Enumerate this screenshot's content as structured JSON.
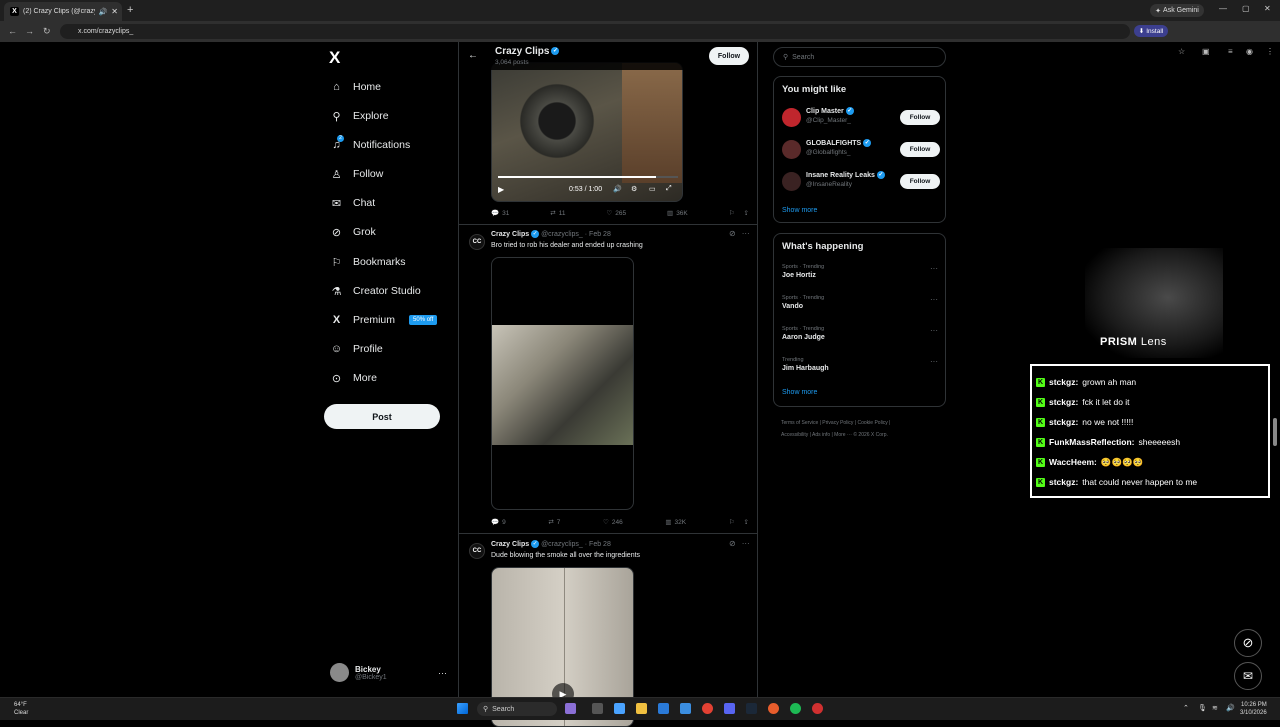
{
  "browser": {
    "tab_title": "(2) Crazy Clips (@crazyclips_",
    "new_tab": "+",
    "ask_gemini": "Ask Gemini",
    "url": "x.com/crazyclips_",
    "install": "Install",
    "window_controls": [
      "—",
      "▢",
      "✕"
    ]
  },
  "sidebar": {
    "logo": "X",
    "items": [
      {
        "label": "Home",
        "icon": "home-icon",
        "glyph": "⌂"
      },
      {
        "label": "Explore",
        "icon": "search-icon",
        "glyph": "⚲"
      },
      {
        "label": "Notifications",
        "icon": "bell-icon",
        "glyph": "🔔"
      },
      {
        "label": "Follow",
        "icon": "add-person-icon",
        "glyph": "⁺"
      },
      {
        "label": "Chat",
        "icon": "mail-icon",
        "glyph": "✉"
      },
      {
        "label": "Grok",
        "icon": "grok-icon",
        "glyph": "⊘"
      },
      {
        "label": "Bookmarks",
        "icon": "bookmark-icon",
        "glyph": "⚑"
      },
      {
        "label": "Creator Studio",
        "icon": "flask-icon",
        "glyph": "⚗"
      },
      {
        "label": "Premium",
        "icon": "x-logo-icon",
        "glyph": "X"
      },
      {
        "label": "Profile",
        "icon": "person-icon",
        "glyph": "☺"
      },
      {
        "label": "More",
        "icon": "more-circle-icon",
        "glyph": "⋯"
      }
    ],
    "premium_badge": "50% off",
    "notifications_count": "2",
    "post_button": "Post",
    "account": {
      "name": "Bickey",
      "handle": "@Bickey1",
      "more": "···"
    }
  },
  "main": {
    "title": "Crazy Clips",
    "subtitle": "3,064 posts",
    "follow": "Follow",
    "video1": {
      "time": "0:53 / 1:00",
      "progress": 0.88
    },
    "tweets": [
      {
        "actions": {
          "replies": "31",
          "reposts": "11",
          "likes": "265",
          "views": "36K"
        }
      },
      {
        "name": "Crazy Clips",
        "handle": "@crazyclips_",
        "date": "· Feb 28",
        "text": "Bro tried to rob his dealer and ended up crashing",
        "avatar_text": "CC",
        "actions": {
          "replies": "9",
          "reposts": "7",
          "likes": "246",
          "views": "32K"
        }
      },
      {
        "name": "Crazy Clips",
        "handle": "@crazyclips_",
        "date": "· Feb 28",
        "text": "Dude blowing the smoke all over the ingredients",
        "avatar_text": "CC"
      }
    ]
  },
  "right": {
    "search_placeholder": "Search",
    "you_might_like": {
      "title": "You might like",
      "accounts": [
        {
          "name": "Clip Master",
          "handle": "@Clip_Master_",
          "follow": "Follow"
        },
        {
          "name": "GLOBALFIGHTS",
          "handle": "@Globalfights_",
          "follow": "Follow"
        },
        {
          "name": "Insane Reality Leaks",
          "handle": "@InsaneReality",
          "follow": "Follow"
        }
      ],
      "show_more": "Show more"
    },
    "whats_happening": {
      "title": "What's happening",
      "trends": [
        {
          "context": "Sports · Trending",
          "topic": "Joe Hortiz"
        },
        {
          "context": "Sports · Trending",
          "topic": "Vando"
        },
        {
          "context": "Sports · Trending",
          "topic": "Aaron Judge"
        },
        {
          "context": "Trending",
          "topic": "Jim Harbaugh"
        }
      ],
      "show_more": "Show more"
    },
    "footer_line1": "Terms of Service  |  Privacy Policy  |  Cookie Policy  |",
    "footer_line2": "Accessibility  |  Ads info  |  More ···  © 2026 X Corp."
  },
  "stream": {
    "brand_bold": "PRISM",
    "brand_rest": " Lens",
    "chat": [
      {
        "user": "stckgz:",
        "msg": "grown ah man"
      },
      {
        "user": "stckgz:",
        "msg": "fck it let do it"
      },
      {
        "user": "stckgz:",
        "msg": "no we not !!!!!"
      },
      {
        "user": "FunkMassReflection:",
        "msg": "sheeeeesh"
      },
      {
        "user": "WaccHeem:",
        "msg": "🥺🥺🥺🥺"
      },
      {
        "user": "stckgz:",
        "msg": "that could never happen to me"
      }
    ],
    "kick_icon": "K"
  },
  "taskbar": {
    "weather_temp": "64°F",
    "weather_desc": "Clear",
    "search": "Search",
    "time": "10:26 PM",
    "date": "3/10/2026"
  },
  "colors": {
    "accent": "#1d9bf0",
    "kick": "#53fc18",
    "background": "#000000"
  }
}
